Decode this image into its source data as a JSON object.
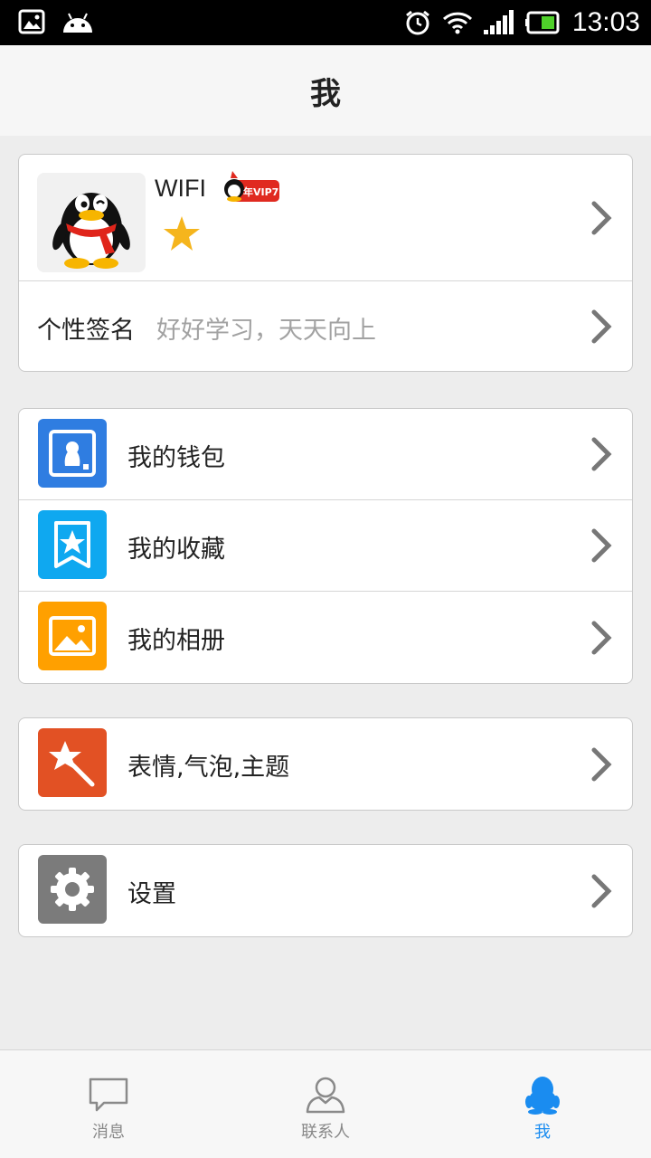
{
  "status_bar": {
    "time": "13:03",
    "icons": [
      "gallery-icon",
      "android-icon",
      "alarm-icon",
      "wifi-icon",
      "signal-icon",
      "battery-icon"
    ]
  },
  "header": {
    "title": "我"
  },
  "profile": {
    "nickname": "WIFI",
    "vip_badge": "年VIP7",
    "signature_label": "个性签名",
    "signature_text": "好好学习，天天向上"
  },
  "menu_group_1": [
    {
      "label": "我的钱包",
      "icon": "wallet-icon",
      "color": "#2f7de1"
    },
    {
      "label": "我的收藏",
      "icon": "favorites-icon",
      "color": "#0fa8f0"
    },
    {
      "label": "我的相册",
      "icon": "album-icon",
      "color": "#ffa000"
    }
  ],
  "menu_group_2": [
    {
      "label": "表情,气泡,主题",
      "icon": "magic-wand-icon",
      "color": "#e25124"
    }
  ],
  "menu_group_3": [
    {
      "label": "设置",
      "icon": "gear-icon",
      "color": "#7b7b7b"
    }
  ],
  "tabs": [
    {
      "label": "消息",
      "icon": "message-icon",
      "active": false
    },
    {
      "label": "联系人",
      "icon": "contacts-icon",
      "active": false
    },
    {
      "label": "我",
      "icon": "me-penguin-icon",
      "active": true
    }
  ],
  "colors": {
    "accent": "#1a8cf0",
    "background": "#ededed",
    "chevron": "#777777",
    "vip_red": "#e02a20"
  }
}
